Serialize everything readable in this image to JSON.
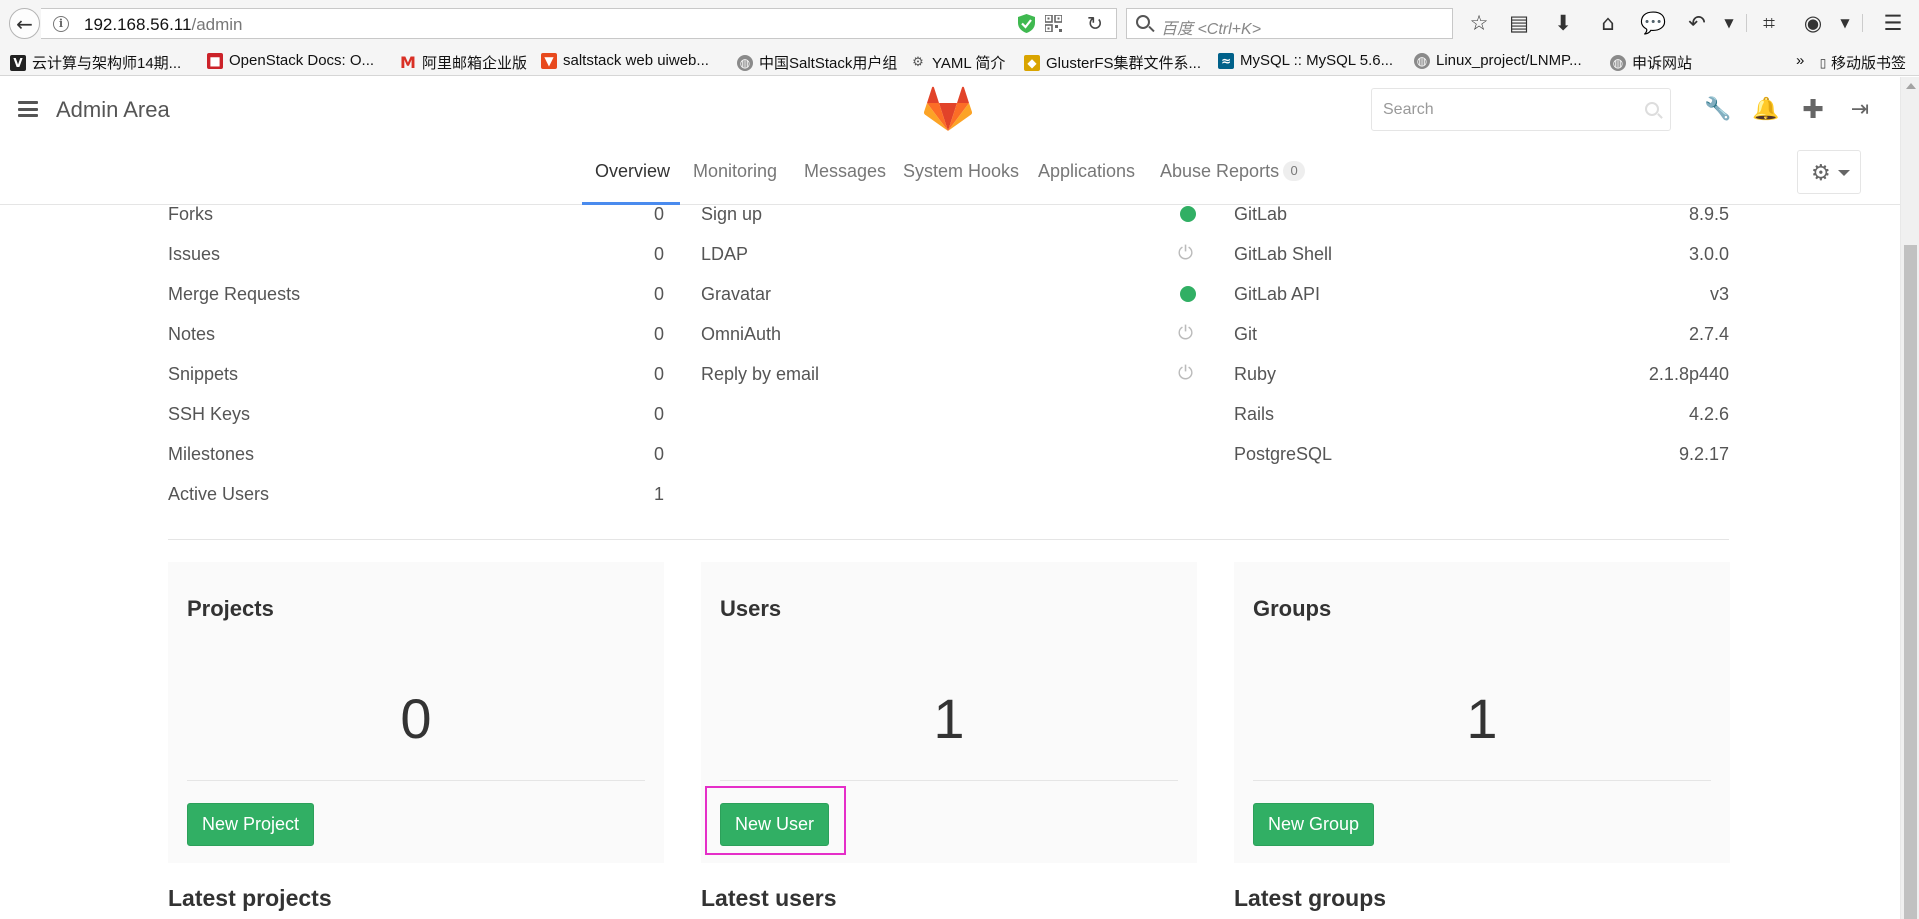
{
  "browser": {
    "url_host": "192.168.56.11",
    "url_path": "/admin",
    "search_placeholder": "百度 <Ctrl+K>"
  },
  "bookmarks": [
    {
      "label": "云计算与架构师14期...",
      "icon": "v-logo-icon",
      "color": "#222222"
    },
    {
      "label": "OpenStack Docs: O...",
      "icon": "openstack-icon",
      "color": "#cc2229"
    },
    {
      "label": "阿里邮箱企业版",
      "icon": "mail-m-icon",
      "color": "#d93025"
    },
    {
      "label": "saltstack web uiweb...",
      "icon": "shield-badge-icon",
      "color": "#e8491d"
    },
    {
      "label": "中国SaltStack用户组",
      "icon": "globe-icon",
      "color": "#8a8a8a"
    },
    {
      "label": "YAML 简介",
      "icon": "yaml-icon",
      "color": "#555555"
    },
    {
      "label": "GlusterFS集群文件系...",
      "icon": "cube-icon",
      "color": "#d9a400"
    },
    {
      "label": "MySQL :: MySQL 5.6...",
      "icon": "mysql-icon",
      "color": "#00618a"
    },
    {
      "label": "Linux_project/LNMP...",
      "icon": "globe-icon",
      "color": "#8a8a8a"
    },
    {
      "label": "申诉网站",
      "icon": "globe-icon",
      "color": "#8a8a8a"
    }
  ],
  "bookmarks_more": "»",
  "mobile_bookmarks": "移动版书签",
  "header": {
    "title": "Admin Area",
    "search_placeholder": "Search"
  },
  "nav": {
    "tabs": [
      {
        "label": "Overview",
        "active": true
      },
      {
        "label": "Monitoring"
      },
      {
        "label": "Messages"
      },
      {
        "label": "System Hooks"
      },
      {
        "label": "Applications"
      },
      {
        "label": "Abuse Reports",
        "badge": "0"
      }
    ]
  },
  "stats": [
    {
      "label": "Forks",
      "value": "0"
    },
    {
      "label": "Issues",
      "value": "0"
    },
    {
      "label": "Merge Requests",
      "value": "0"
    },
    {
      "label": "Notes",
      "value": "0"
    },
    {
      "label": "Snippets",
      "value": "0"
    },
    {
      "label": "SSH Keys",
      "value": "0"
    },
    {
      "label": "Milestones",
      "value": "0"
    },
    {
      "label": "Active Users",
      "value": "1"
    }
  ],
  "features": [
    {
      "label": "Sign up",
      "enabled": true
    },
    {
      "label": "LDAP",
      "enabled": false
    },
    {
      "label": "Gravatar",
      "enabled": true
    },
    {
      "label": "OmniAuth",
      "enabled": false
    },
    {
      "label": "Reply by email",
      "enabled": false
    }
  ],
  "components": [
    {
      "label": "GitLab",
      "value": "8.9.5"
    },
    {
      "label": "GitLab Shell",
      "value": "3.0.0"
    },
    {
      "label": "GitLab API",
      "value": "v3"
    },
    {
      "label": "Git",
      "value": "2.7.4"
    },
    {
      "label": "Ruby",
      "value": "2.1.8p440"
    },
    {
      "label": "Rails",
      "value": "4.2.6"
    },
    {
      "label": "PostgreSQL",
      "value": "9.2.17"
    }
  ],
  "cards": {
    "projects": {
      "title": "Projects",
      "count": "0",
      "button": "New Project"
    },
    "users": {
      "title": "Users",
      "count": "1",
      "button": "New User"
    },
    "groups": {
      "title": "Groups",
      "count": "1",
      "button": "New Group"
    }
  },
  "latest": {
    "projects": "Latest projects",
    "users": "Latest users",
    "groups": "Latest groups"
  },
  "colors": {
    "accent_green": "#31af64",
    "nav_underline": "#4a8bee",
    "highlight_box": "#e52ec8"
  }
}
